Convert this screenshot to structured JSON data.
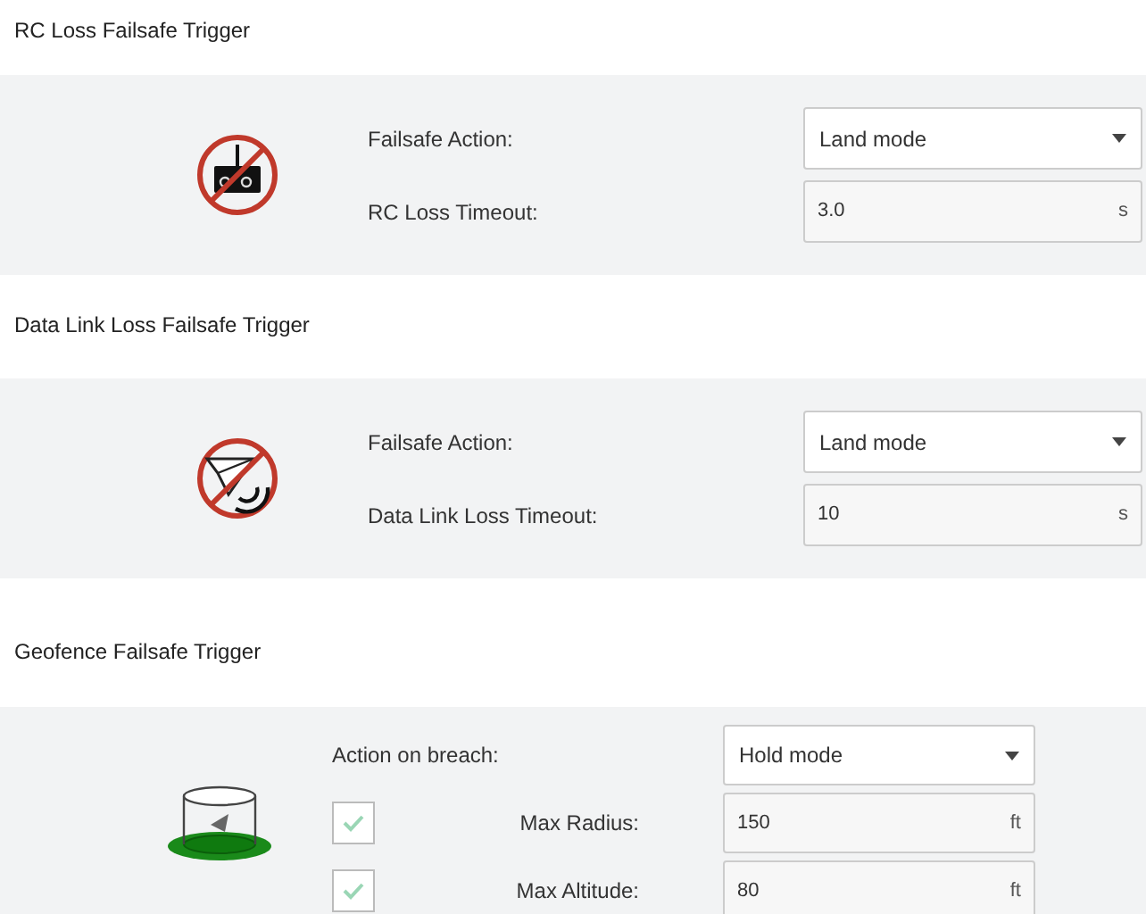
{
  "sections": [
    {
      "kind": "rc",
      "title": "RC Loss Failsafe Trigger",
      "rows": [
        {
          "kind": "select",
          "label": "Failsafe Action:",
          "value": "Land mode"
        },
        {
          "kind": "number",
          "label": "RC Loss Timeout:",
          "value": "3.0",
          "unit": "s"
        }
      ]
    },
    {
      "kind": "datalink",
      "title": "Data Link Loss Failsafe Trigger",
      "rows": [
        {
          "kind": "select",
          "label": "Failsafe Action:",
          "value": "Land mode"
        },
        {
          "kind": "number",
          "label": "Data Link Loss Timeout:",
          "value": "10",
          "unit": "s"
        }
      ]
    },
    {
      "kind": "geofence",
      "title": "Geofence Failsafe Trigger",
      "rows": [
        {
          "kind": "select",
          "label": "Action on breach:",
          "value": "Hold mode"
        },
        {
          "kind": "check_number",
          "label": "Max Radius:",
          "checked": true,
          "value": "150",
          "unit": "ft"
        },
        {
          "kind": "check_number",
          "label": "Max Altitude:",
          "checked": true,
          "value": "80",
          "unit": "ft"
        }
      ]
    }
  ]
}
